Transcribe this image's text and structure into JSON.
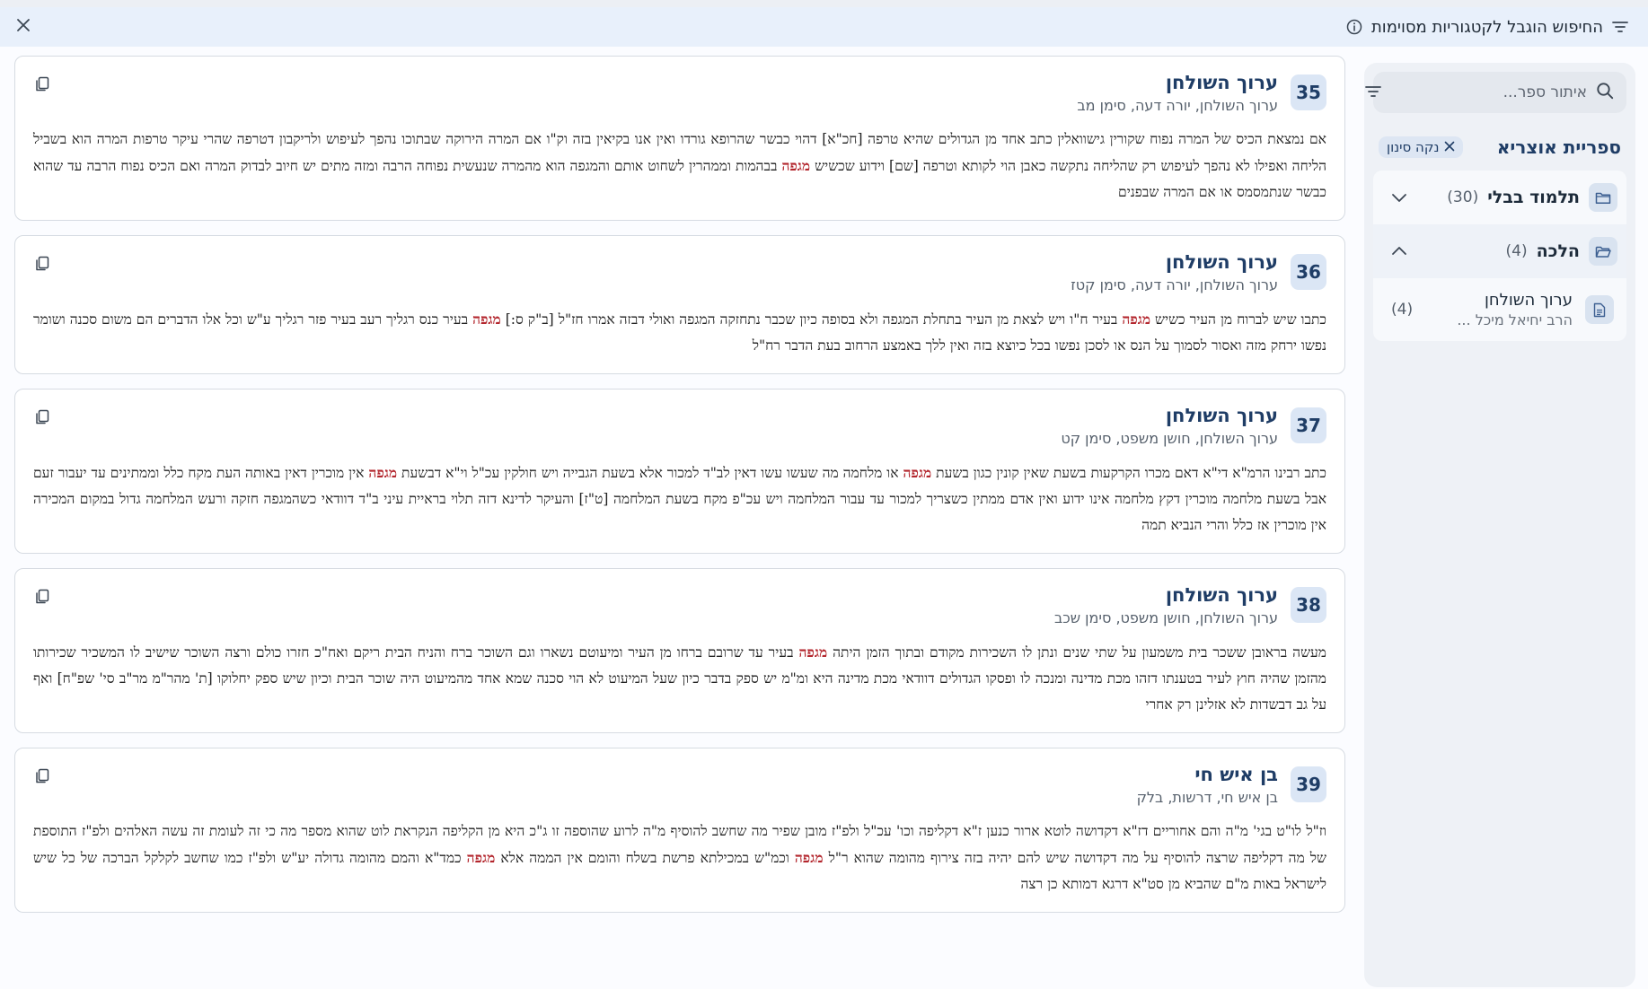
{
  "banner": {
    "text": "החיפוש הוגבל לקטגוריות מסוימות",
    "filter_icon": "filter-lines-icon",
    "info_icon": "info-circle-icon",
    "close_icon": "close-x-icon"
  },
  "sidebar": {
    "search_placeholder": "איתור ספר...",
    "library_title": "ספריית אוצריא",
    "clear_filter_label": "נקה סינון",
    "tree": [
      {
        "label": "תלמוד בבלי",
        "count": "(30)",
        "expanded": false
      },
      {
        "label": "הלכה",
        "count": "(4)",
        "expanded": true
      }
    ],
    "leaf": {
      "title": "ערוך השולחן",
      "subtitle": "הרב יחיאל מיכל ...",
      "count": "(4)"
    }
  },
  "highlight_word": "מגפה",
  "results": [
    {
      "number": "35",
      "title": "ערוך השולחן",
      "ref": "ערוך השולחן, יורה דעה, סימן מב",
      "text": "אם נמצאת הכיס של המרה נפוח שקורין גישוואלין כתב אחד מן הגדולים שהיא טרפה [חכ\"א] דהוי כבשר שהרופא גורדו ואין אנו בקיאין בזה וק\"ו אם המרה הירוקה שבתוכו נהפך לעיפוש ולריקבון דטרפה שהרי עיקר טרפות המרה הוא בשביל הליחה ואפילו לא נהפך לעיפוש רק שהליחה נתקשה כאבן הוי לקותא וטרפה [שם] וידוע שכשיש {{מגפה}} בבהמות וממהרין לשחוט אותם והמגפה הוא מהמרה שנעשית נפוחה הרבה ומזה מתים יש חיוב לבדוק המרה ואם הכיס נפוח הרבה עד שהוא כבשר שנתמסמס או אם המרה שבפנים"
    },
    {
      "number": "36",
      "title": "ערוך השולחן",
      "ref": "ערוך השולחן, יורה דעה, סימן קטז",
      "text": "כתבו שיש לברוח מן העיר כשיש {{מגפה}} בעיר ח\"ו ויש לצאת מן העיר בתחלת המגפה ולא בסופה כיון שכבר נתחזקה המגפה ואולי דבזה אמרו חז\"ל [ב\"ק ס:] {{מגפה}} בעיר כנס רגליך רעב בעיר פזר רגליך ע\"ש וכל אלו הדברים הם משום סכנה ושומר נפשו ירחק מזה ואסור לסמוך על הנס או לסכן נפשו בכל כיוצא בזה ואין ללך באמצע הרחוב בעת הדבר רח\"ל"
    },
    {
      "number": "37",
      "title": "ערוך השולחן",
      "ref": "ערוך השולחן, חושן משפט, סימן קט",
      "text": "כתב רבינו הרמ\"א די\"א דאם מכרו הקרקעות בשעת שאין קונין כגון בשעת {{מגפה}} או מלחמה מה שעשו עשו דאין לב\"ד למכור אלא בשעת הגבייה ויש חולקין עכ\"ל וי\"א דבשעת {{מגפה}} אין מוכרין דאין באותה העת מקח כלל וממתינים עד יעבור זעם אבל בשעת מלחמה מוכרין דקץ מלחמה אינו ידוע ואין אדם ממתין כשצריך למכור עד עבור המלחמה ויש עכ\"פ מקח בשעת המלחמה [ט\"ז] והעיקר לדינא דזה תלוי בראיית עיני ב\"ד דוודאי כשהמגפה חזקה ורעש המלחמה גדול במקום המכירה אין מוכרין אז כלל והרי הנביא תמה"
    },
    {
      "number": "38",
      "title": "ערוך השולחן",
      "ref": "ערוך השולחן, חושן משפט, סימן שכב",
      "text": "מעשה בראובן ששכר בית משמעון על שתי שנים ונתן לו השכירות מקודם ובתוך הזמן היתה {{מגפה}} בעיר עד שרובם ברחו מן העיר ומיעוטם נשארו וגם השוכר ברח והניח הבית ריקם ואח\"כ חזרו כולם ורצה השוכר שישיב לו המשכיר שכירותו מהזמן שהיה חוץ לעיר בטענתו דזהו מכת מדינה ומנכה לו ופסקו הגדולים דוודאי מכת מדינה היא ומ\"מ יש ספק בדבר כיון שעל המיעוט לא הוי סכנה שמא אחד מהמיעוט היה שוכר הבית וכיון שיש ספק יחלוקו [ת' מהר\"מ מר\"ב סי' שפ\"ח] ואף על גב דבשדות לא אזלינן רק אחרי"
    },
    {
      "number": "39",
      "title": "בן איש חי",
      "ref": "בן איש חי, דרשות, בלק",
      "text": "וז\"ל לו\"ט בגי' מ\"ה והם אחוריים דז\"א דקדושה לוטא ארור כנען ז\"א דקליפה וכו' עכ\"ל ולפ\"ז מובן שפיר מה שחשב להוסיף מ\"ה לרוע שהוספה זו ג\"כ היא מן הקליפה הנקראת לוט שהוא מספר מה כי זה לעומת זה עשה האלהים ולפ\"ז התוספת של מה דקליפה שרצה להוסיף על מה דקדושה שיש להם יהיה בזה צירוף מהומה שהוא ר\"ל {{מגפה}} וכמ\"ש במכילתא פרשת בשלח והומם אין הממה אלא {{מגפה}} כמד\"א והמם מהומה גדולה יע\"ש ולפ\"ז כמו שחשב לקלקל הברכה של כל שיש לישראל באות מ\"ם שהביא מן סט\"א דרגא דמותא כן רצה"
    }
  ]
}
